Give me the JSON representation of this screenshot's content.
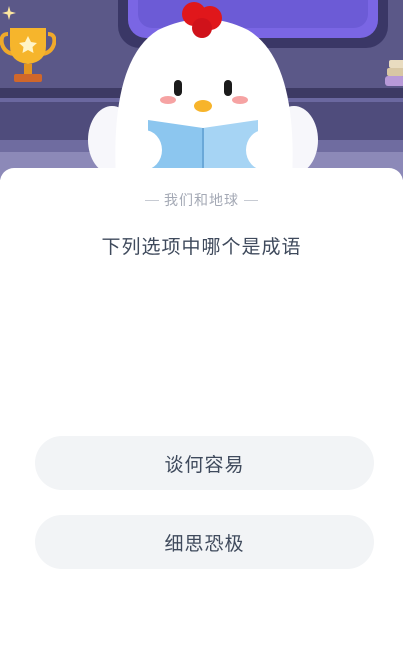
{
  "quiz": {
    "category": "我们和地球",
    "question": "下列选项中哪个是成语",
    "options": [
      {
        "label": "谈何容易"
      },
      {
        "label": "细思恐极"
      }
    ]
  },
  "illustration": {
    "mascot": "chick-reading-book",
    "props": [
      "trophy-icon",
      "star-sparkle-icon",
      "books-icon"
    ],
    "colors": {
      "wall": "#5d5a8a",
      "shelf": "#3e3b66",
      "screen": "#6c5fd6",
      "comb": "#e0171b",
      "book": "#8fc8f0"
    }
  }
}
